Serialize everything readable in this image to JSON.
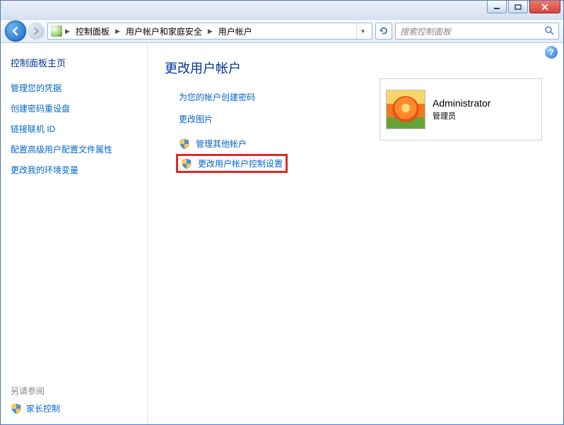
{
  "titlebar": {},
  "nav": {
    "crumbs": [
      "控制面板",
      "用户帐户和家庭安全",
      "用户帐户"
    ]
  },
  "search": {
    "placeholder": "搜索控制面板"
  },
  "sidebar": {
    "title": "控制面板主页",
    "links": [
      "管理您的凭据",
      "创建密码重设盘",
      "链接联机 ID",
      "配置高级用户配置文件属性",
      "更改我的环境变量"
    ],
    "see_also": "另请参阅",
    "parental": "家长控制"
  },
  "content": {
    "title": "更改用户帐户",
    "actions": [
      "为您的帐户创建密码",
      "更改图片"
    ],
    "shield_actions": [
      "管理其他帐户",
      "更改用户帐户控制设置"
    ]
  },
  "account": {
    "name": "Administrator",
    "type": "管理员"
  }
}
